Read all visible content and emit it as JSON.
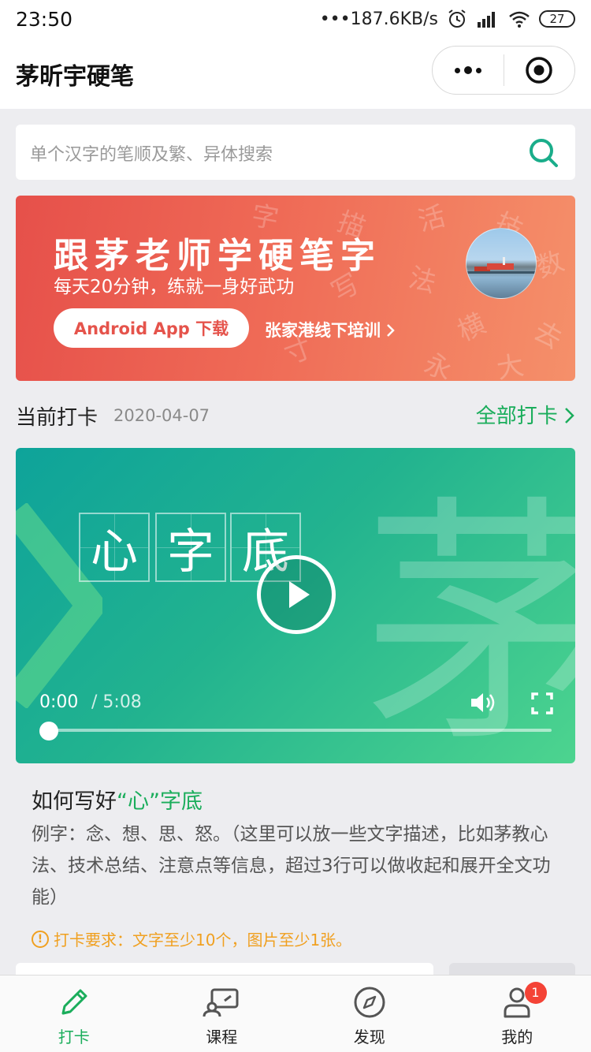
{
  "status_bar": {
    "time": "23:50",
    "speed": "•••187.6KB/s",
    "battery": "27"
  },
  "nav": {
    "title": "茅昕宇硬笔"
  },
  "search": {
    "placeholder": "单个汉字的笔顺及繁、异体搜索"
  },
  "banner": {
    "headline": "跟茅老师学硬笔字",
    "subtitle": "每天20分钟，练就一身好武功",
    "app_button": "Android App 下载",
    "offline_link": "张家港线下培训",
    "decor_chars": [
      "描",
      "活",
      "技",
      "数",
      "法",
      "横",
      "去",
      "大",
      "写",
      "永",
      "寸",
      "字"
    ]
  },
  "checkin": {
    "label": "当前打卡",
    "date": "2020-04-07",
    "all_link": "全部打卡"
  },
  "video": {
    "chars": [
      "心",
      "字",
      "底"
    ],
    "watermark": "茅",
    "current_time": "0:00",
    "total_time": "/ 5:08",
    "progress": 0
  },
  "lesson": {
    "title_pre": "如何写好",
    "title_hl": "“心”字底",
    "description": "例字：念、想、思、怒。（这里可以放一些文字描述，比如茅教心法、技术总结、注意点等信息，超过3行可以做收起和展开全文功能）",
    "requirement": "打卡要求：文字至少10个，图片至少1张。"
  },
  "tabs": [
    {
      "label": "打卡",
      "icon": "pen-icon",
      "active": true
    },
    {
      "label": "课程",
      "icon": "course-icon",
      "active": false
    },
    {
      "label": "发现",
      "icon": "compass-icon",
      "active": false
    },
    {
      "label": "我的",
      "icon": "user-icon",
      "active": false,
      "badge": "1"
    }
  ],
  "colors": {
    "accent": "#1aad5b",
    "banner_start": "#e6504a",
    "banner_end": "#f5906a",
    "warning": "#f0a020",
    "badge": "#f44336"
  }
}
